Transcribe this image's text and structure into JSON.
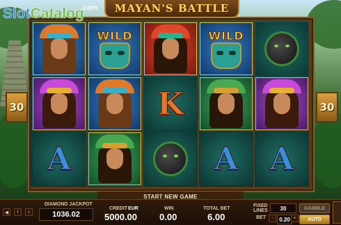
{
  "logo": {
    "slot": "Slot",
    "catalog": "Catalog",
    "com": ".com"
  },
  "game": {
    "title": "MAYAN'S BATTLE",
    "message": "START NEW GAME"
  },
  "side_numbers": {
    "left": "30",
    "right": "30"
  },
  "reels": [
    [
      {
        "symbol": "warrior-woman-orange",
        "bg": "blue"
      },
      {
        "symbol": "warrior-woman-purple",
        "bg": "purple"
      },
      {
        "symbol": "letter",
        "text": "A",
        "bg": "teal"
      }
    ],
    [
      {
        "symbol": "wild",
        "text": "WILD",
        "bg": "blue"
      },
      {
        "symbol": "warrior-woman-orange",
        "bg": "blue"
      },
      {
        "symbol": "warrior-woman-green",
        "bg": "green"
      }
    ],
    [
      {
        "symbol": "warrior-woman-feathers",
        "bg": "red"
      },
      {
        "symbol": "letter",
        "text": "K",
        "bg": "teal"
      },
      {
        "symbol": "panther",
        "bg": "teal"
      }
    ],
    [
      {
        "symbol": "wild",
        "text": "WILD",
        "bg": "blue"
      },
      {
        "symbol": "warrior-woman-green",
        "bg": "green"
      },
      {
        "symbol": "letter",
        "text": "A",
        "bg": "teal"
      }
    ],
    [
      {
        "symbol": "panther",
        "bg": "teal"
      },
      {
        "symbol": "warrior-woman-purple",
        "bg": "purple"
      },
      {
        "symbol": "letter",
        "text": "A",
        "bg": "teal"
      }
    ]
  ],
  "panel": {
    "jackpot_label": "DIAMOND JACKPOT",
    "jackpot_value": "1036.02",
    "credit_label": "CREDIT",
    "currency": "EUR",
    "credit_value": "5000.00",
    "win_label": "WIN",
    "win_value": "0.00",
    "total_bet_label": "TOTAL BET",
    "total_bet_value": "6.00",
    "fixed_lines_label": "FIXED\nLINES",
    "lines_value": "30",
    "bet_label": "BET",
    "bet_value": "0.20",
    "gamble_label": "GAMBLE",
    "auto_label": "AUTO",
    "minus": "-",
    "plus": "+"
  },
  "colors": {
    "accent": "#ffd35a",
    "frame": "#5c3a1c",
    "reel_bg": "#0d3b35"
  }
}
